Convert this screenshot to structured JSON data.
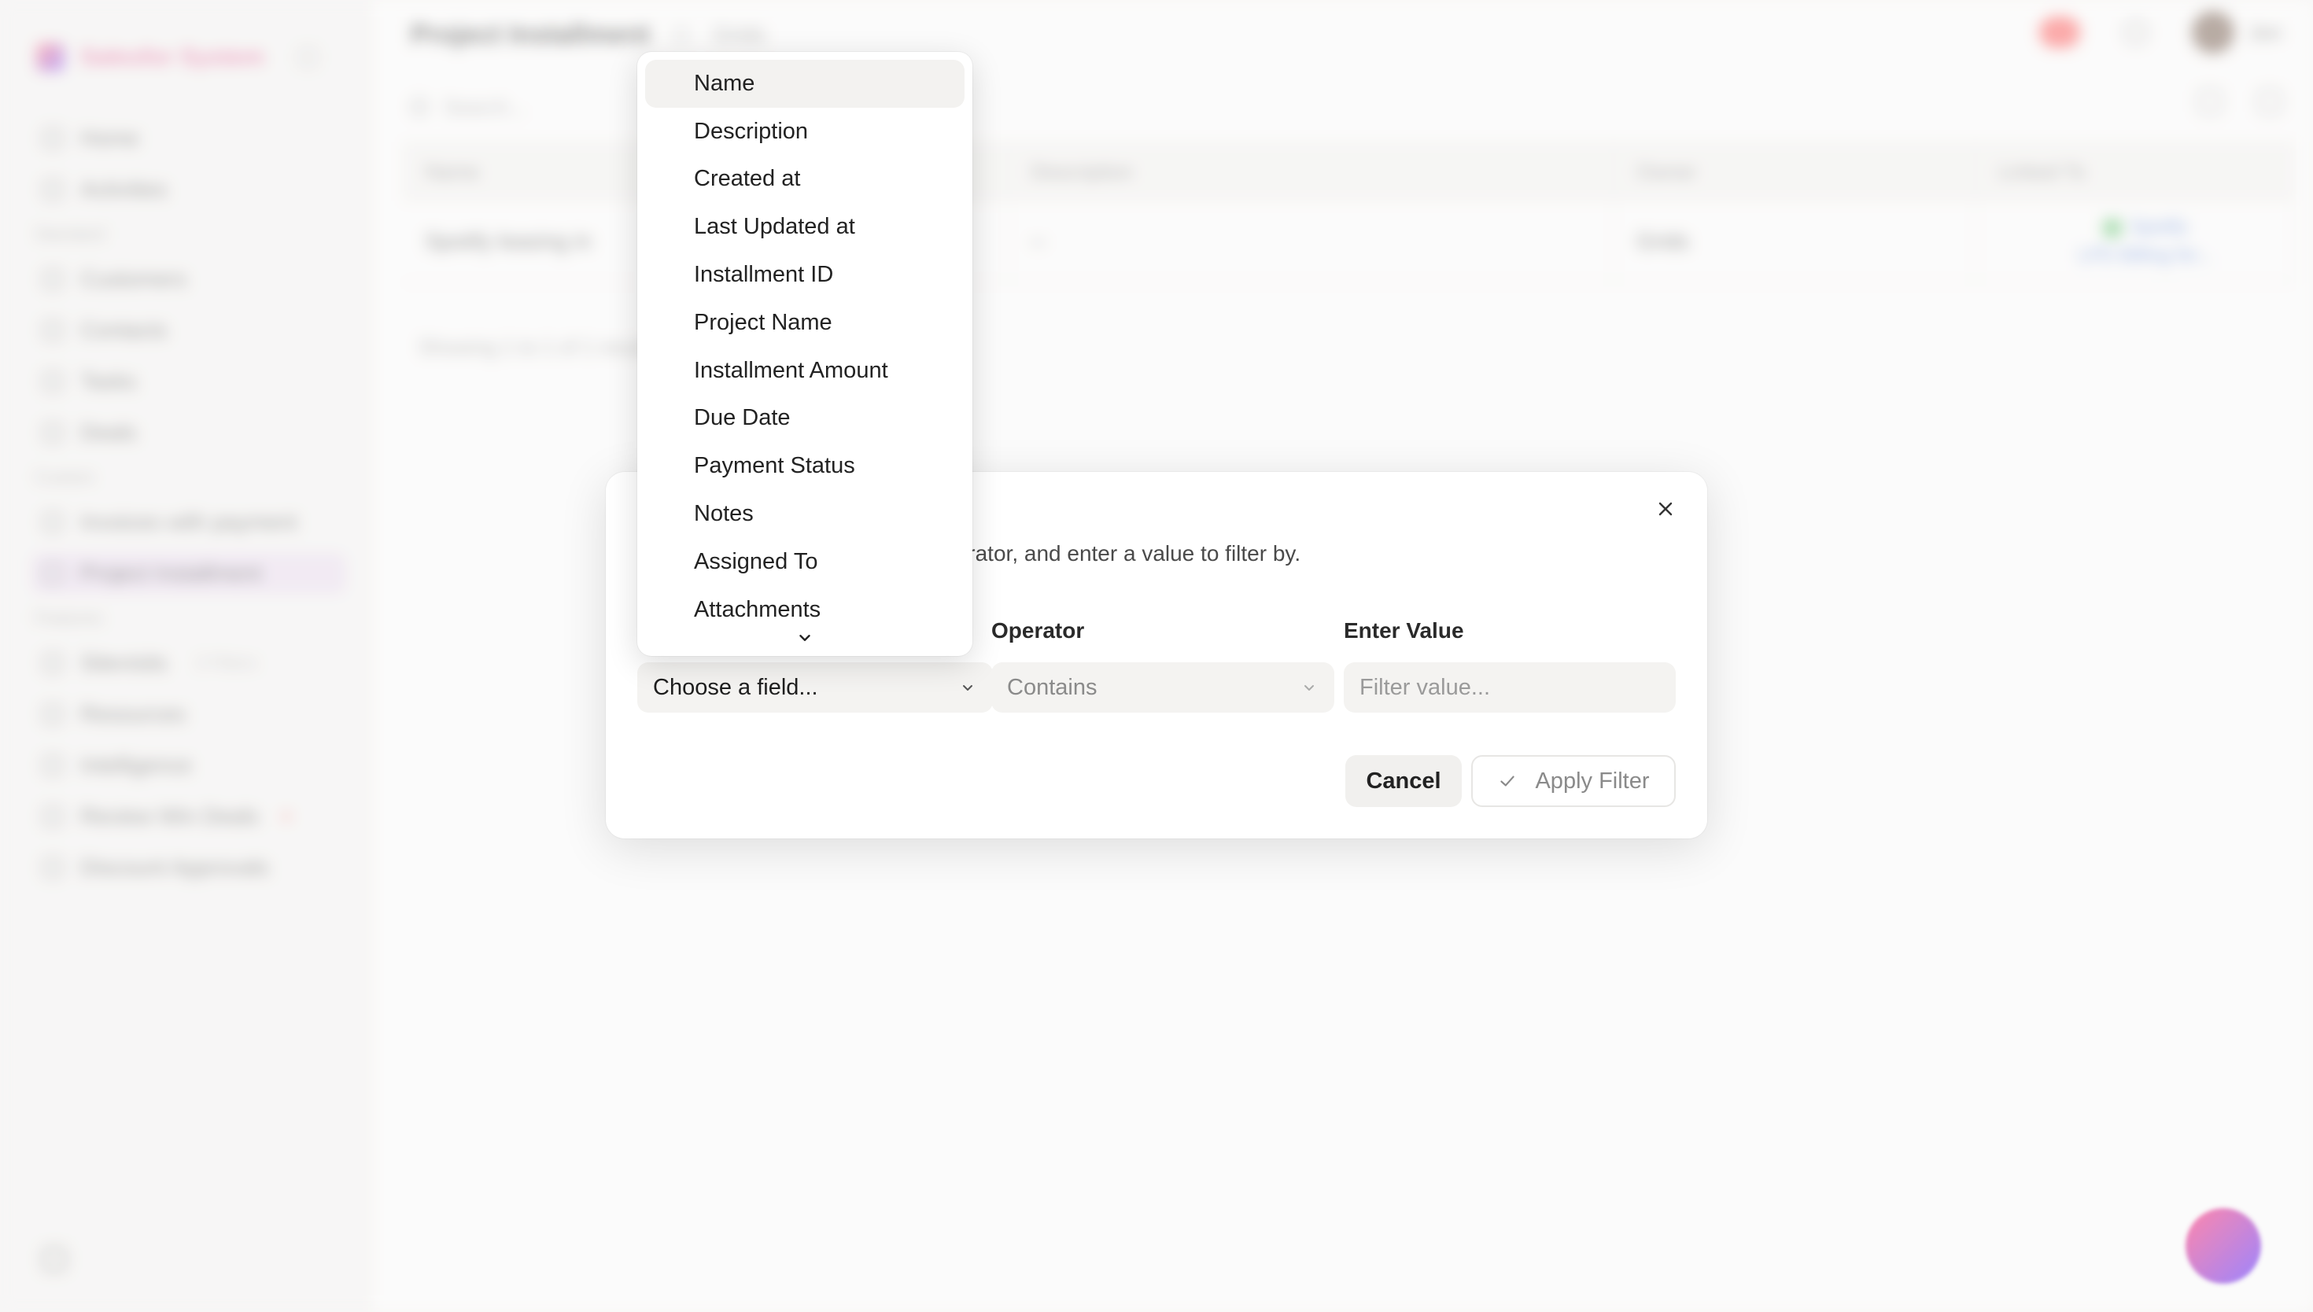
{
  "background": {
    "sidebar": {
      "workspace_name": "Salesfor System",
      "top_items": [
        {
          "label": "Home",
          "icon": "home-icon"
        },
        {
          "label": "Activities",
          "icon": "activity-icon"
        }
      ],
      "sections": [
        {
          "label": "Standard",
          "items": [
            {
              "label": "Customers",
              "icon": "building-icon"
            },
            {
              "label": "Contacts",
              "icon": "user-icon"
            },
            {
              "label": "Tasks",
              "icon": "check-square-icon"
            },
            {
              "label": "Deals",
              "icon": "handshake-icon"
            }
          ]
        },
        {
          "label": "Custom",
          "items": [
            {
              "label": "Invoices with payment",
              "icon": "table-icon"
            },
            {
              "label": "Project Installment",
              "icon": "table-icon",
              "active": true
            }
          ]
        },
        {
          "label": "Features",
          "items": [
            {
              "label": "Sitevisits",
              "badge": "2 Filters",
              "icon": "map-pin-icon"
            },
            {
              "label": "Resources",
              "icon": "folder-icon"
            },
            {
              "label": "Intelligence",
              "icon": "sparkle-icon"
            },
            {
              "label": "Review Win Deals",
              "icon": "star-icon",
              "dot": true
            },
            {
              "label": "Discount Approvals",
              "icon": "percent-icon"
            }
          ]
        }
      ]
    },
    "header": {
      "title": "Project Installment",
      "subtitle": "Grids",
      "user_name": "Jon"
    },
    "search_placeholder": "Search...",
    "table": {
      "columns": [
        "Name",
        "Description",
        "Owner",
        "Linked To"
      ],
      "rows": [
        {
          "name": "Spotify leasing in",
          "description": "--",
          "owner": "Grids",
          "linked_1": "Spotify",
          "linked_2": "LPD Billing for..."
        }
      ],
      "footer": "Showing 1 to 1 of 1 results"
    }
  },
  "modal": {
    "description": "ues. Select a field, choose an operator, and enter a value to filter by.",
    "field_select": {
      "placeholder": "Choose a field..."
    },
    "operator": {
      "label": "Operator",
      "value": "Contains"
    },
    "value": {
      "label": "Enter Value",
      "placeholder": "Filter value..."
    },
    "buttons": {
      "cancel": "Cancel",
      "apply": "Apply Filter"
    }
  },
  "dropdown": {
    "highlighted_index": 0,
    "options": [
      "Name",
      "Description",
      "Created at",
      "Last Updated at",
      "Installment ID",
      "Project Name",
      "Installment Amount",
      "Due Date",
      "Payment Status",
      "Notes",
      "Assigned To",
      "Attachments"
    ]
  },
  "colors": {
    "accent": "#e14b8a",
    "modal_bg": "#ffffff",
    "input_bg": "#f4f3f1"
  }
}
